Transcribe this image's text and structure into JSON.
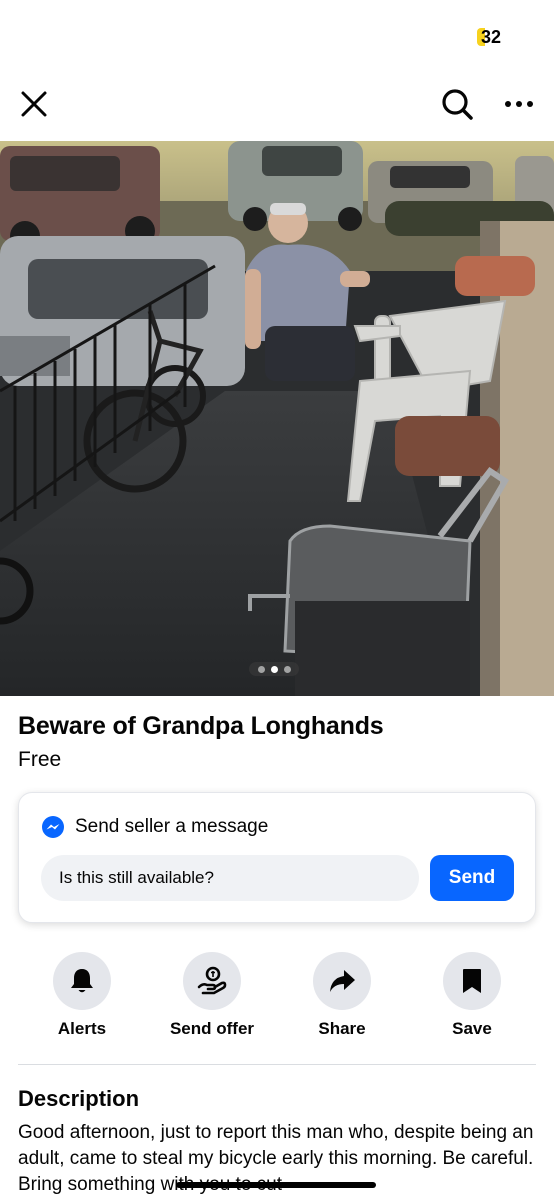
{
  "status_bar": {
    "battery_level": "32",
    "battery_color": "#f7d21e"
  },
  "nav": {
    "close_icon": "close-icon",
    "search_icon": "search-icon",
    "more_icon": "more-icon"
  },
  "photo": {
    "description_icon": "listing-photo",
    "page_count": 3,
    "active_page": 2
  },
  "listing": {
    "title": "Beware of Grandpa Longhands",
    "price": "Free"
  },
  "message_card": {
    "heading": "Send seller a message",
    "input_value": "Is this still available?",
    "send_label": "Send",
    "accent_color": "#0866ff"
  },
  "actions": [
    {
      "label": "Alerts",
      "icon": "bell-icon"
    },
    {
      "label": "Send offer",
      "icon": "offer-icon"
    },
    {
      "label": "Share",
      "icon": "share-icon"
    },
    {
      "label": "Save",
      "icon": "bookmark-icon"
    }
  ],
  "description": {
    "heading": "Description",
    "text": "Good afternoon, just to report this man who, despite being an adult, came to steal my bicycle early this morning. Be careful. Bring something with you to cut"
  }
}
